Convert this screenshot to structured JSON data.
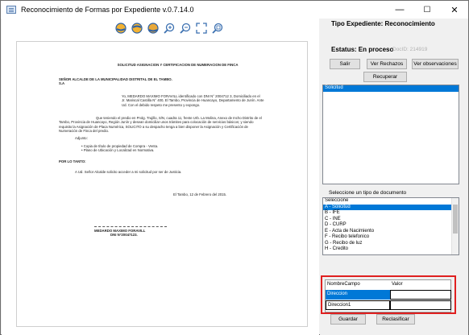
{
  "window": {
    "title": "Reconocimiento de Formas por Expediente v.0.7.14.0",
    "minimize": "—",
    "maximize": "☐",
    "close": "✕"
  },
  "toolbar": {
    "icons": [
      "globe-left-icon",
      "globe-right-icon",
      "globe-icon",
      "zoom-in-icon",
      "zoom-out-icon",
      "fit-icon",
      "zoom-reset-icon"
    ]
  },
  "document": {
    "title": "SOLICITUD ASIGNACION Y CERTIFICACION DE NUMERACION DE FINCA",
    "addressee": "SEÑOR ALCALDE DE LA MUNICIPALIDAD DISTRITAL DE EL TAMBO.",
    "addressee2": "S.A",
    "intro": "Yo, MEDARDO MAXIMO FORAVILL identificado con DNI N° 2004712 3, Domiciliado en el Jr. Mariscal Castilla N° 400, El Tambo, Provincia de Huancayo, Departamento de Junín. Ante Ud. Con el debido respeto me presento y expongo.",
    "body": "Que teniendo el predio en Prolg. Trujillo, S/N, cuadra 11, frente Urb. La Molina, Anexo de Incho Distrito de el Tambo, Provincia de Huancayo, Región Junín y desean domiciliar unos trámites para colocación de servicios básicos; y siendo requisito la Asignación de Placa Numérica, SOLICITO a su despacho tenga a bien disponer la Asignación y Certificación de Numeración de Finca del predio.",
    "adjunto": "Adjunto:",
    "items": [
      "Copia de título de propiedad de Compra - Venta.",
      "Plano de Ubicación y Localizad en Normativa."
    ],
    "porlotanto": "POR LO TANTO:",
    "request": "A Ud. Señor Alcalde solicito acceder a mi solicitud por ser de Justicia.",
    "date": "El Tambo, 12 de Febrero del 2015.",
    "signer": "MEDARDO MAXIMO FORAVILL",
    "dni": "DNI N°20047123."
  },
  "panel": {
    "tipo": "Tipo Expediente: Reconocimiento",
    "estatus": "Estatus: En proceso",
    "docid": "DocID: 214919",
    "buttons": {
      "salir": "Salir",
      "rechazos": "Ver Rechazos",
      "observaciones": "Ver observaciones",
      "recuperar": "Recuperar"
    },
    "pages_list": [
      "Solicitud"
    ],
    "tipo_doc_label": "Seleccione un tipo de documento",
    "doc_types": [
      "Seleccione",
      "A - Solicitud",
      "B - IFE",
      "C - INE",
      "D - CURP",
      "E - Acta de Nacimiento",
      "F - Recibo telefonico",
      "G - Recibo de luz",
      "H - Credito"
    ],
    "grid": {
      "headers": [
        "NombreCampo",
        "Valor"
      ],
      "rows": [
        {
          "campo": "Direccion",
          "valor": ""
        },
        {
          "campo": "Direccion1",
          "valor": ""
        }
      ]
    },
    "guardar": "Guardar",
    "reclasificar": "Reclasificar"
  }
}
